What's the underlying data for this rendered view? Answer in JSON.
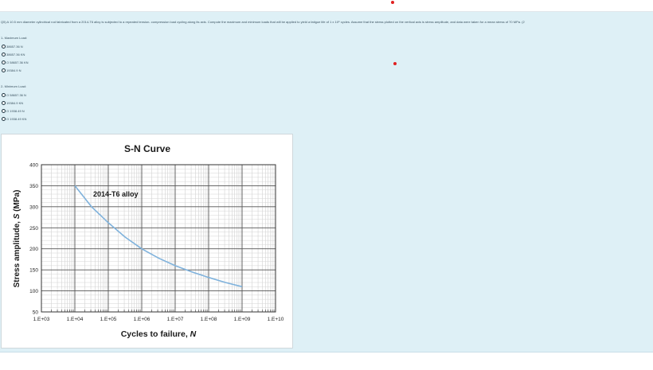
{
  "question": {
    "text": "Q5) A 10.5 mm diameter cylindrical rod fabricated from a 2014-T6 alloy is subjected to a repeated tension- compression load cycling along its axis. Compute the maximum and minimum loads that will be applied to yield a fatigue life of 1 x 10⁶ cycles. Assume that the stress plotted on the vertical axis is stress amplitude, and data were taken for a mean stress of 70 MPa. (2"
  },
  "groups": [
    {
      "title": "1- Maximum Load:",
      "options": [
        "38657.36 N",
        "38657.36 KN",
        "O 58657.36 KN",
        "19384.9 N"
      ]
    },
    {
      "title": "2- Minimum Load:",
      "options": [
        "O 58657.36 N",
        "19384.9 KN",
        "O 1938.49 N",
        "O 1938.49 KN"
      ]
    }
  ],
  "colors": {
    "accent_dot": "#e02020",
    "panel_bg": "#def0f6",
    "curve": "#7fb2dc"
  },
  "chart_data": {
    "type": "line",
    "title": "S-N Curve",
    "xlabel": "Cycles to failure, N",
    "ylabel": "Stress amplitude, S (MPa)",
    "x_scale": "log",
    "xlim": [
      1000,
      10000000000
    ],
    "ylim": [
      50,
      400
    ],
    "x_ticks": [
      "1.E+03",
      "1.E+04",
      "1.E+05",
      "1.E+06",
      "1.E+07",
      "1.E+08",
      "1.E+09",
      "1.E+10"
    ],
    "y_ticks": [
      "50",
      "100",
      "150",
      "200",
      "250",
      "300",
      "350",
      "400"
    ],
    "annotation": "2014-T6 alloy",
    "grid": true,
    "series": [
      {
        "x": [
          10000,
          31600,
          100000,
          316000,
          1000000,
          3160000,
          10000000,
          31600000,
          100000000,
          316000000,
          1000000000
        ],
        "y": [
          350,
          300,
          262,
          228,
          200,
          178,
          160,
          145,
          132,
          120,
          110
        ]
      }
    ]
  }
}
